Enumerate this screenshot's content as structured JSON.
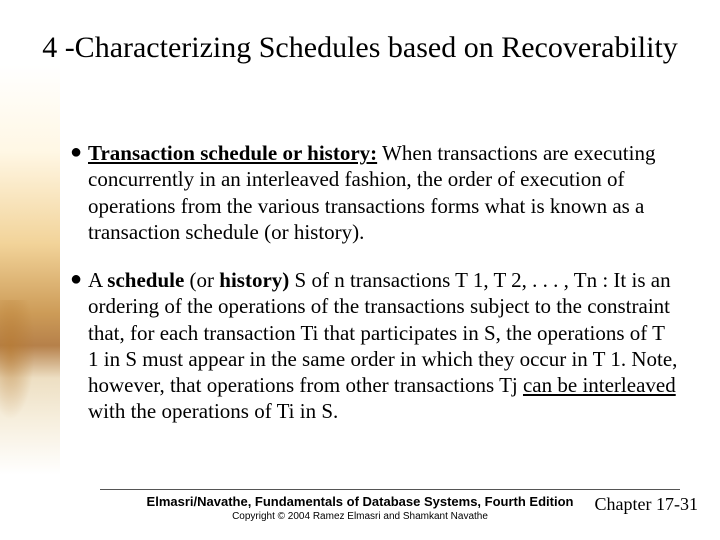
{
  "title": "4 -Characterizing Schedules based on Recoverability",
  "bullets": [
    {
      "lead_bold_underline": "Transaction schedule or history:",
      "rest": " When transactions are executing concurrently in an interleaved fashion, the order of execution of operations from the various transactions forms what is known as a transaction schedule (or history)."
    },
    {
      "pre": "A ",
      "bold1": "schedule",
      "mid1": " (or ",
      "bold2": "history)",
      "mid2": " S of n transactions T 1, T 2, . . . , Tn : It is an ordering of the operations of the transactions subject to the constraint that, for each transaction Ti that participates in S, the operations of T 1 in S must appear in the same order in which they occur in T 1. Note, however, that operations from other transactions Tj ",
      "underline": "can be interleaved",
      "post": " with the operations of Ti in S."
    }
  ],
  "footer": {
    "book": "Elmasri/Navathe, Fundamentals of Database Systems, Fourth Edition",
    "chapter": "Chapter 17-31",
    "copyright": "Copyright © 2004 Ramez Elmasri and Shamkant Navathe"
  }
}
